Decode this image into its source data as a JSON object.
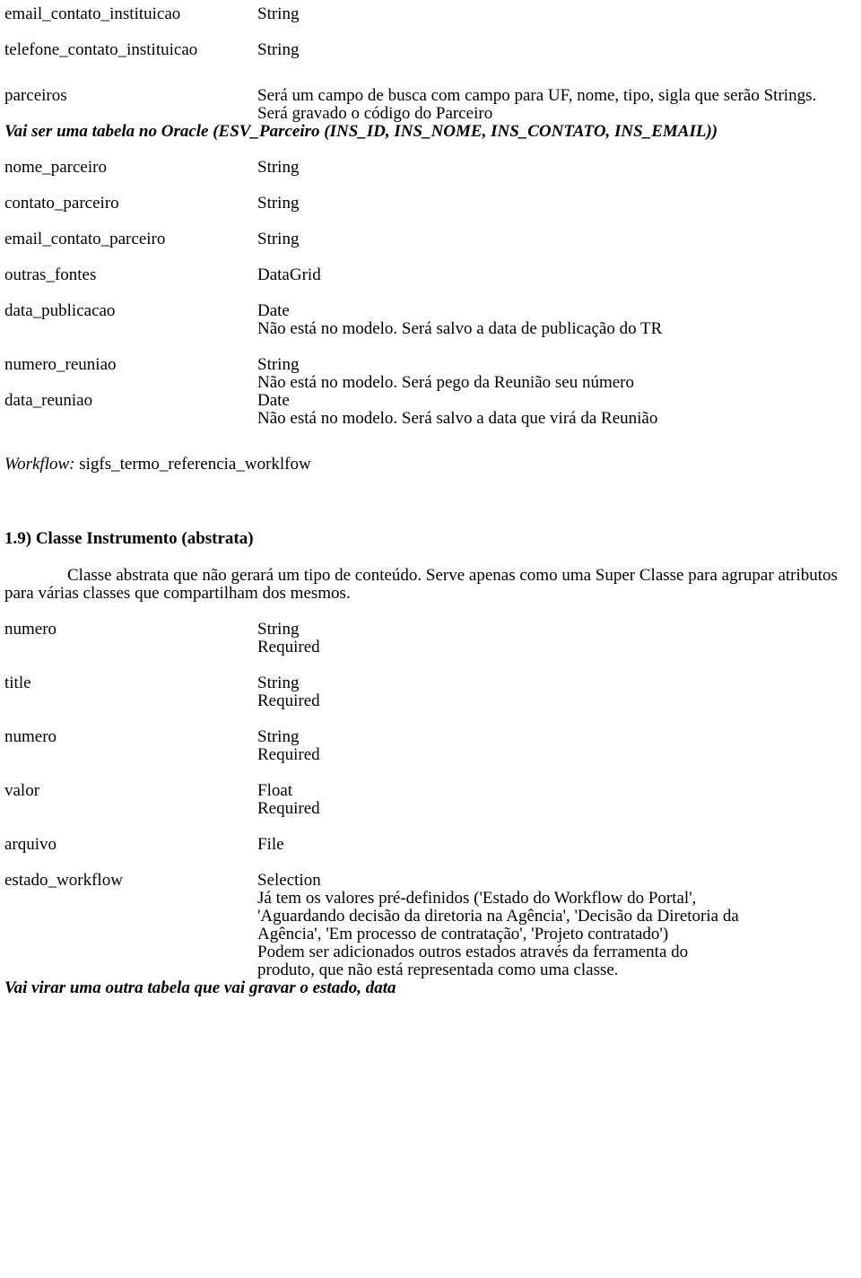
{
  "document": {
    "section_top": {
      "rows": [
        {
          "name": "email_contato_instituicao",
          "values": [
            "String"
          ]
        },
        {
          "name": "telefone_contato_instituicao",
          "values": [
            "String"
          ]
        },
        {
          "name": "parceiros",
          "values": [
            "Será um campo de busca com campo para UF, nome, tipo, sigla que serão Strings.",
            "Será gravado o código do Parceiro"
          ]
        }
      ],
      "oracle_note": "Vai ser uma tabela no Oracle (ESV_Parceiro (INS_ID, INS_NOME, INS_CONTATO, INS_EMAIL))"
    },
    "section_parceiro": {
      "rows": [
        {
          "name": "nome_parceiro",
          "values": [
            "String"
          ]
        },
        {
          "name": "contato_parceiro",
          "values": [
            "String"
          ]
        },
        {
          "name": "email_contato_parceiro",
          "values": [
            "String"
          ]
        },
        {
          "name": "outras_fontes",
          "values": [
            "DataGrid"
          ]
        },
        {
          "name": "data_publicacao",
          "values": [
            "Date",
            "Não está no modelo. Será salvo a data de publicação do TR"
          ]
        },
        {
          "name": "numero_reuniao",
          "values": [
            "String",
            "Não está no modelo. Será pego da Reunião seu número"
          ]
        },
        {
          "name": "data_reuniao",
          "values": [
            "Date",
            "Não está no modelo. Será salvo a data que virá da Reunião"
          ]
        }
      ]
    },
    "workflow": {
      "label": "Workflow:",
      "value": " sigfs_termo_referencia_worklfow"
    },
    "section_instrumento": {
      "heading": "1.9) Classe Instrumento (abstrata)",
      "paragraph": "Classe abstrata que não gerará um tipo de conteúdo. Serve apenas como uma Super Classe para agrupar atributos para várias classes que compartilham dos mesmos.",
      "rows": [
        {
          "name": "numero",
          "values": [
            "String",
            "Required"
          ]
        },
        {
          "name": "title",
          "values": [
            "String",
            "Required"
          ]
        },
        {
          "name": "numero",
          "values": [
            "String",
            "Required"
          ]
        },
        {
          "name": "valor",
          "values": [
            "Float",
            "Required"
          ]
        },
        {
          "name": "arquivo",
          "values": [
            "File"
          ]
        },
        {
          "name": "estado_workflow",
          "values": [
            "Selection",
            "Já tem os valores pré-definidos ('Estado do Workflow do Portal',",
            "'Aguardando decisão da diretoria na Agência', 'Decisão da Diretoria da",
            "Agência', 'Em processo de contratação', 'Projeto contratado')",
            "Podem ser adicionados outros estados através da ferramenta do",
            "produto, que não está representada como uma classe."
          ]
        }
      ],
      "footer_note": "Vai virar uma outra tabela que vai gravar o estado, data"
    }
  }
}
